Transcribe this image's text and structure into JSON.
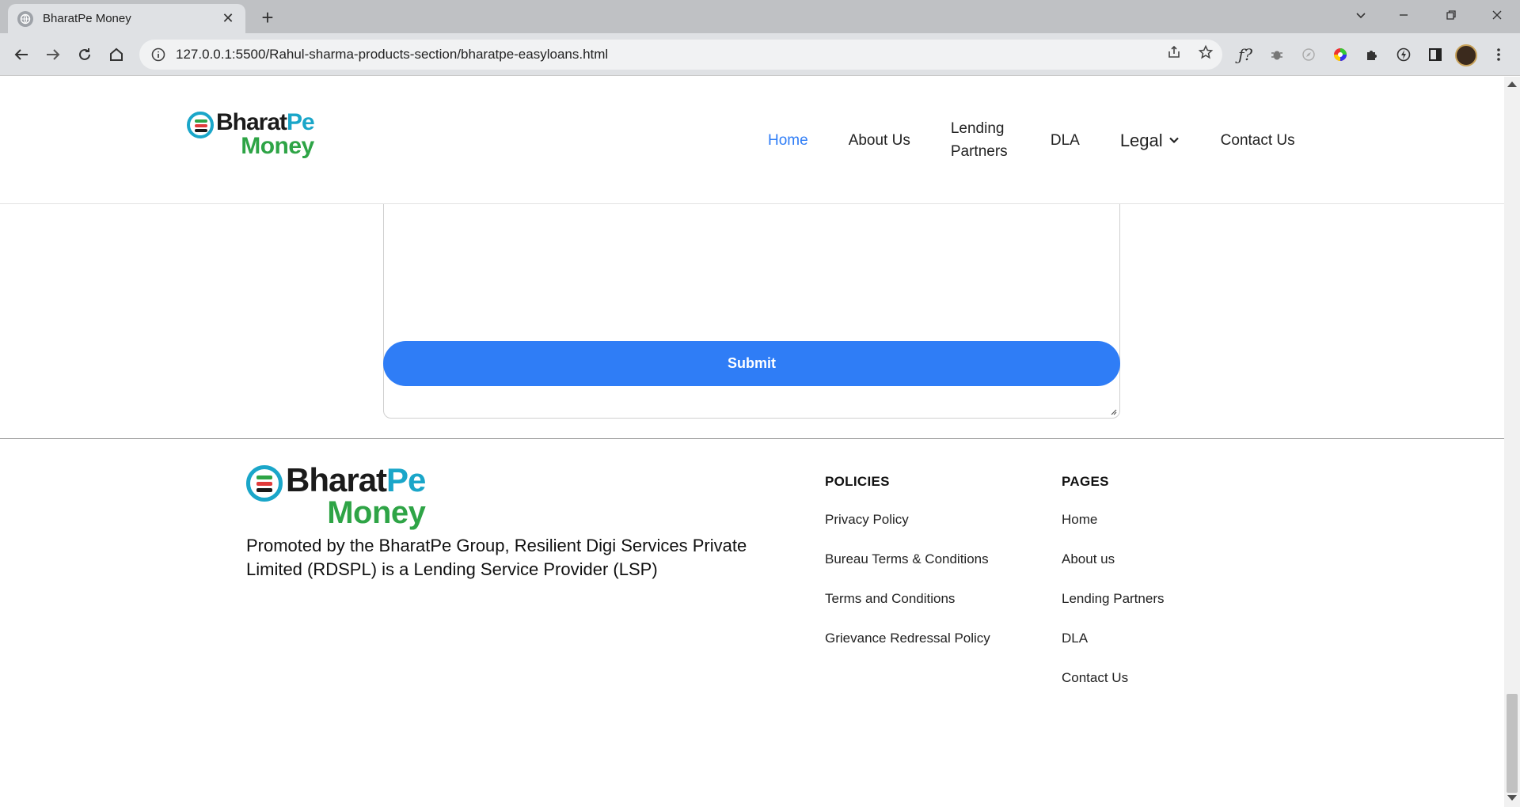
{
  "browser": {
    "tab_title": "BharatPe Money",
    "url": "127.0.0.1:5500/Rahul-sharma-products-section/bharatpe-easyloans.html",
    "tab_close": "✕",
    "new_tab": "+"
  },
  "logo": {
    "top_left": "Bharat",
    "top_right": "Pe",
    "bottom": "Money"
  },
  "nav": {
    "home": "Home",
    "about": "About Us",
    "lending": "Lending Partners",
    "dla": "DLA",
    "legal": "Legal",
    "contact": "Contact Us"
  },
  "form": {
    "submit_label": "Submit"
  },
  "footer": {
    "description": "Promoted by the BharatPe Group, Resilient Digi Services Private Limited (RDSPL) is a Lending Service Provider (LSP)",
    "policies": {
      "title": "POLICIES",
      "links": [
        "Privacy Policy",
        "Bureau Terms & Conditions",
        "Terms and Conditions",
        "Grievance Redressal Policy"
      ]
    },
    "pages": {
      "title": "PAGES",
      "links": [
        "Home",
        "About us",
        "Lending Partners",
        "DLA",
        "Contact Us"
      ]
    }
  },
  "colors": {
    "accent": "#2f7df6",
    "brand_teal": "#1aa6c9",
    "brand_green": "#2ea446"
  }
}
